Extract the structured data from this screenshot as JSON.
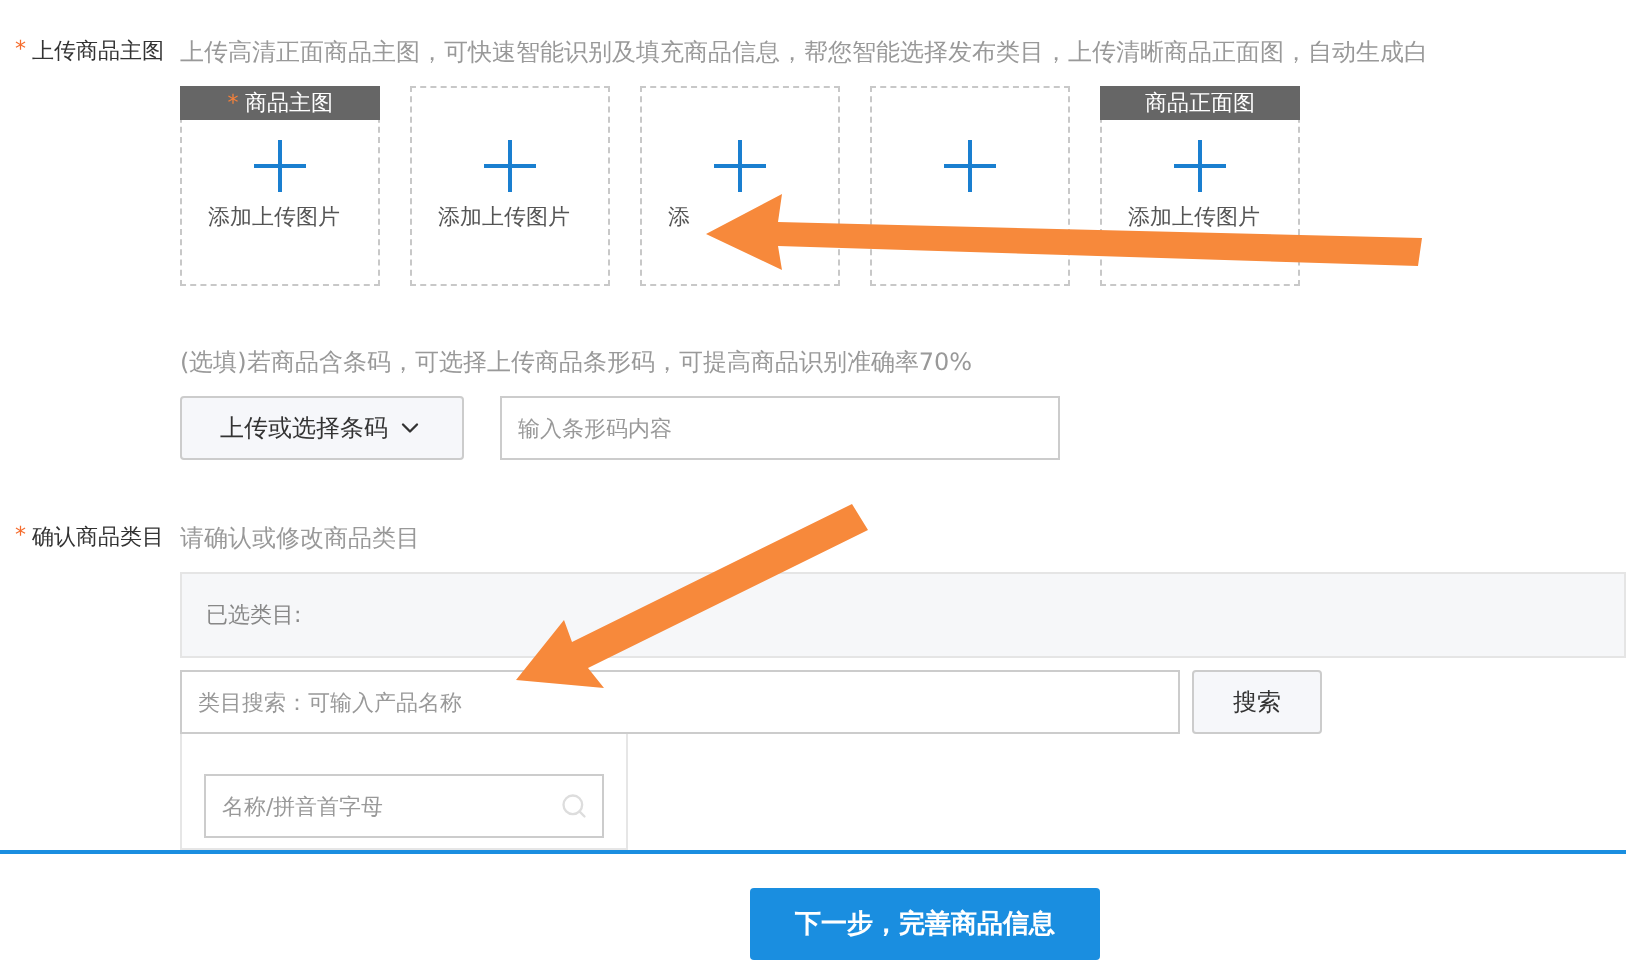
{
  "upload_images": {
    "mark": "*",
    "label": "上传商品主图",
    "hint": "上传高清正面商品主图，可快速智能识别及填充商品信息，帮您智能选择发布类目，上传清晰商品正面图，自动生成白",
    "slots": [
      {
        "kind": "headed",
        "header_mark": "*",
        "header": "商品主图",
        "label": "添加上传图片"
      },
      {
        "kind": "plain",
        "label": "添加上传图片"
      },
      {
        "kind": "plain",
        "label": "添"
      },
      {
        "kind": "plain"
      },
      {
        "kind": "headed",
        "header": "商品正面图",
        "label": "添加上传图片"
      }
    ]
  },
  "barcode": {
    "hint": "(选填)若商品含条码，可选择上传商品条形码，可提高商品识别准确率70%",
    "button": "上传或选择条码",
    "placeholder": "输入条形码内容"
  },
  "category": {
    "mark": "*",
    "label": "确认商品类目",
    "hint": "请确认或修改商品类目",
    "selected_label": "已选类目:",
    "search_placeholder": "类目搜索：可输入产品名称",
    "search_button": "搜索",
    "filter_placeholder": "名称/拼音首字母"
  },
  "next_button": "下一步，完善商品信息"
}
